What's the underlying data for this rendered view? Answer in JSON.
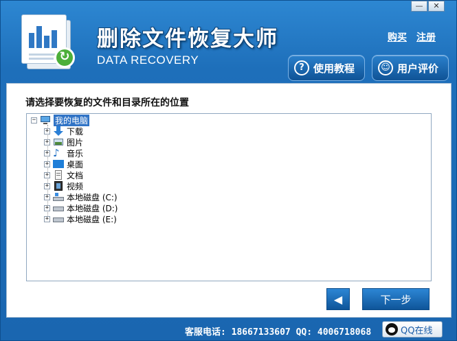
{
  "window": {
    "minimize_label": "—",
    "close_label": "✕"
  },
  "header": {
    "title_cn": "删除文件恢复大师",
    "title_en": "DATA RECOVERY",
    "buy_link": "购买",
    "register_link": "注册",
    "tutorial_button": "使用教程",
    "review_button": "用户评价",
    "tutorial_icon": "question-icon",
    "review_icon": "user-review-icon"
  },
  "panel": {
    "prompt": "请选择要恢复的文件和目录所在的位置"
  },
  "tree": {
    "root": {
      "label": "我的电脑",
      "icon": "computer-icon",
      "expander": "⊟"
    },
    "items": [
      {
        "label": "下载",
        "icon": "download-arrow-icon",
        "expander": "+"
      },
      {
        "label": "图片",
        "icon": "picture-icon",
        "expander": "+"
      },
      {
        "label": "音乐",
        "icon": "music-note-icon",
        "expander": "+"
      },
      {
        "label": "桌面",
        "icon": "desktop-icon",
        "expander": "+"
      },
      {
        "label": "文档",
        "icon": "document-icon",
        "expander": "+"
      },
      {
        "label": "视频",
        "icon": "video-icon",
        "expander": "+"
      },
      {
        "label": "本地磁盘 (C:)",
        "icon": "system-drive-icon",
        "expander": "+"
      },
      {
        "label": "本地磁盘 (D:)",
        "icon": "drive-icon",
        "expander": "+"
      },
      {
        "label": "本地磁盘 (E:)",
        "icon": "drive-icon",
        "expander": "+"
      }
    ]
  },
  "nav": {
    "back_label": "◀",
    "next_label": "下一步"
  },
  "footer": {
    "service_text": "客服电话: 18667133607 QQ: 4006718068",
    "qq_button": "QQ在线"
  },
  "colors": {
    "window_blue": "#1d6fb8",
    "selection_blue": "#3174c6",
    "button_blue": "#0f5599"
  }
}
